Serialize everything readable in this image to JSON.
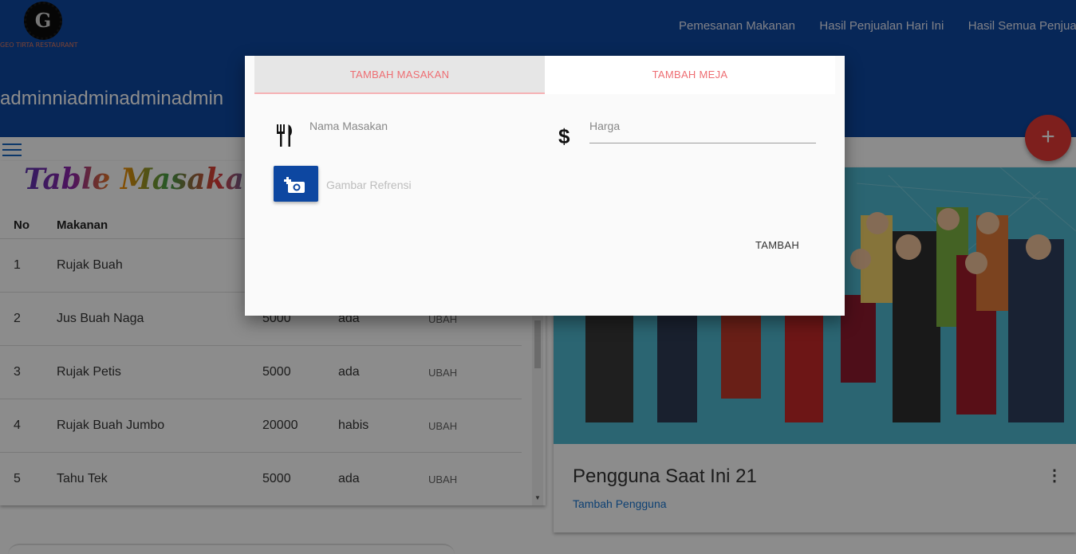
{
  "header": {
    "logo_text": "GEO TIRTA RESTAURANT",
    "nav": [
      "Pemesanan Makanan",
      "Hasil Penjualan Hari Ini",
      "Hasil Semua Penjualan"
    ],
    "username": "adminniadminadminadmin",
    "background_color": "#0d47a1"
  },
  "fab": {
    "label": "+",
    "color": "#e53935"
  },
  "table": {
    "title": "Table Masakan",
    "columns": [
      "No",
      "Makanan"
    ],
    "rows": [
      {
        "no": "1",
        "name": "Rujak Buah",
        "price": "",
        "status": "",
        "action": ""
      },
      {
        "no": "2",
        "name": "Jus Buah Naga",
        "price": "5000",
        "status": "ada",
        "action": "UBAH"
      },
      {
        "no": "3",
        "name": "Rujak Petis",
        "price": "5000",
        "status": "ada",
        "action": "UBAH"
      },
      {
        "no": "4",
        "name": "Rujak Buah Jumbo",
        "price": "20000",
        "status": "habis",
        "action": "UBAH"
      },
      {
        "no": "5",
        "name": "Tahu Tek",
        "price": "5000",
        "status": "ada",
        "action": "UBAH"
      }
    ]
  },
  "users_card": {
    "title": "Pengguna Saat Ini 21",
    "link": "Tambah Pengguna",
    "menu_icon": "more-vert-icon"
  },
  "modal": {
    "tabs": [
      "TAMBAH MASAKAN",
      "TAMBAH MEJA"
    ],
    "active_tab": 0,
    "name_label": "Nama Masakan",
    "price_label": "Harga",
    "name_icon": "utensils-icon",
    "price_icon": "dollar-icon",
    "photo_icon": "add-photo-icon",
    "photo_placeholder": "Gambar Refrensi",
    "submit_label": "TAMBAH",
    "accent_color": "#ee6e73"
  }
}
